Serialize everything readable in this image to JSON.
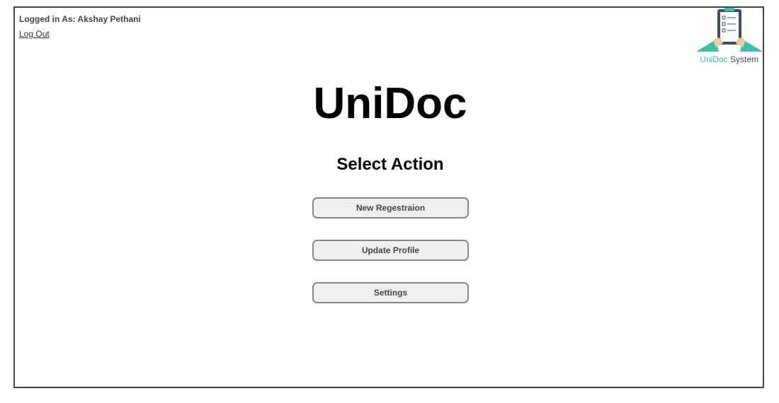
{
  "header": {
    "user_label": "Logged in As: Akshay Pethani",
    "logout_label": "Log Out"
  },
  "logo": {
    "icon": "clipboard-checklist-icon",
    "caption_uni": "UniDoc",
    "caption_system": " System",
    "accent_color": "#3bbfa8",
    "dark_color": "#3f4f5f"
  },
  "main": {
    "app_title": "UniDoc",
    "section_title": "Select Action",
    "buttons": [
      {
        "label": "New Regestraion"
      },
      {
        "label": "Update Profile"
      },
      {
        "label": "Settings"
      }
    ]
  }
}
